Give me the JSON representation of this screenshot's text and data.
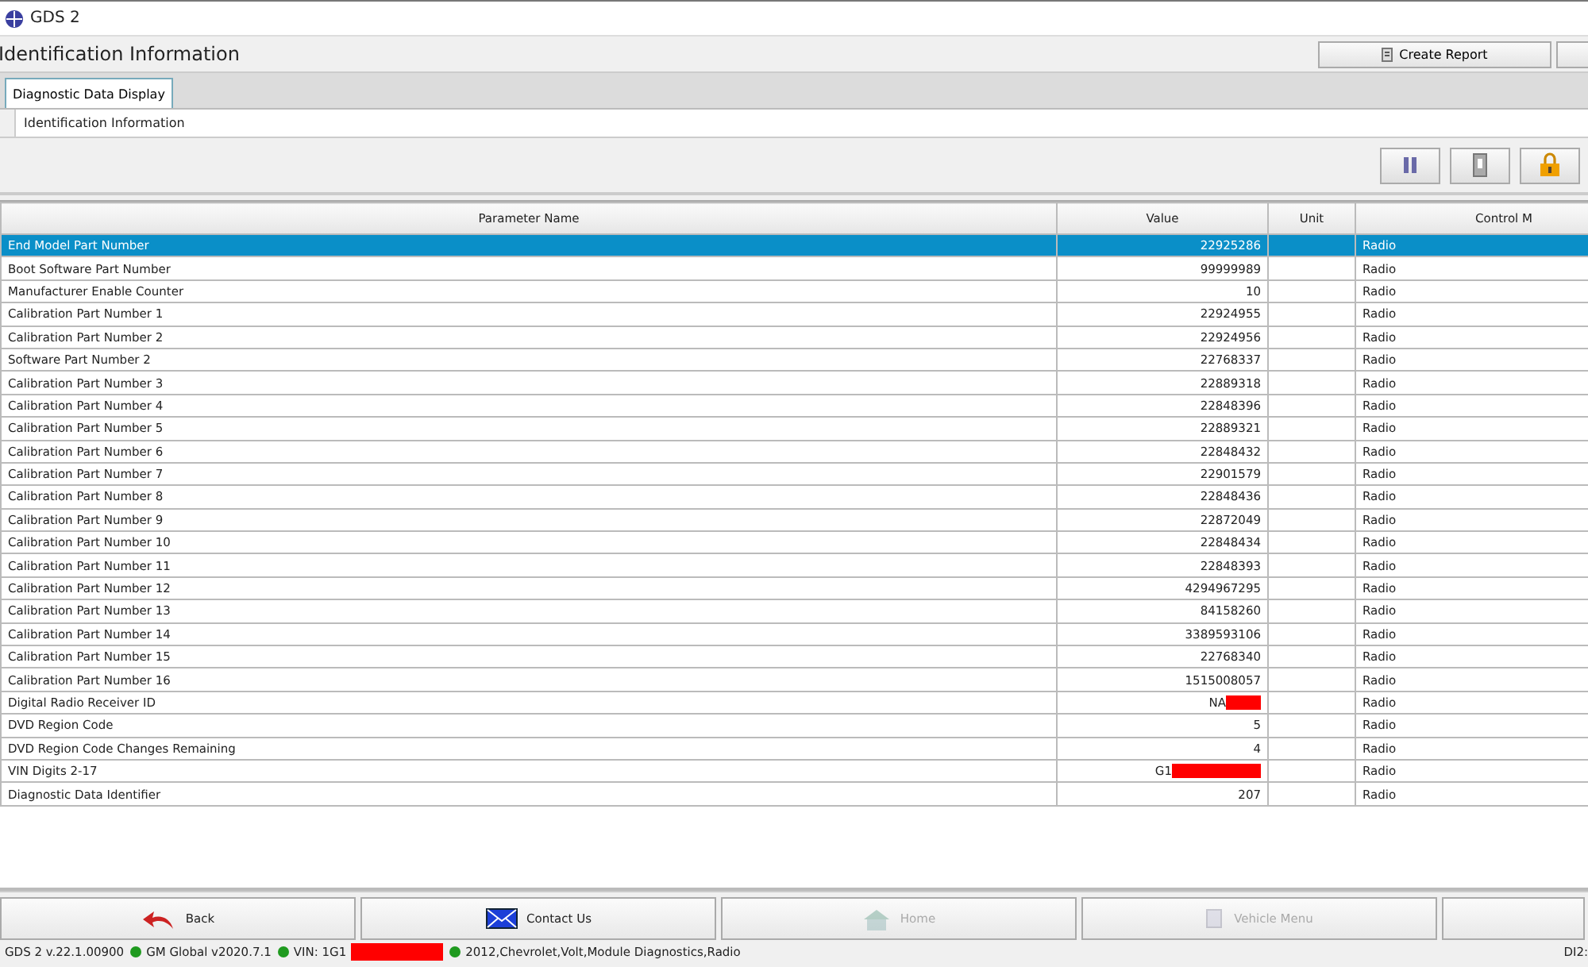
{
  "window": {
    "title": "GDS 2"
  },
  "header": {
    "title": "Identification Information",
    "buttons": [
      {
        "label": "Create Report",
        "kind": "report"
      },
      {
        "kind": "blank"
      }
    ]
  },
  "tabs": [
    {
      "label": "Diagnostic Data Display",
      "selected": true
    }
  ],
  "breadcrumb": "Identification Information",
  "toolbar": [
    {
      "kind": "pause"
    },
    {
      "kind": "switch"
    },
    {
      "kind": "lock"
    }
  ],
  "table": {
    "columns": [
      "Parameter Name",
      "Value",
      "Unit",
      "Control M"
    ],
    "rows": [
      {
        "name": "End Model Part Number",
        "value": "22925286",
        "unit": "",
        "module": "Radio",
        "selected": true
      },
      {
        "name": "Boot Software Part Number",
        "value": "99999989",
        "unit": "",
        "module": "Radio",
        "selected": false
      },
      {
        "name": "Manufacturer Enable Counter",
        "value": "10",
        "unit": "",
        "module": "Radio",
        "selected": false
      },
      {
        "name": "Calibration Part Number 1",
        "value": "22924955",
        "unit": "",
        "module": "Radio",
        "selected": false
      },
      {
        "name": "Calibration Part Number 2",
        "value": "22924956",
        "unit": "",
        "module": "Radio",
        "selected": false
      },
      {
        "name": "Software Part Number 2",
        "value": "22768337",
        "unit": "",
        "module": "Radio",
        "selected": false
      },
      {
        "name": "Calibration Part Number 3",
        "value": "22889318",
        "unit": "",
        "module": "Radio",
        "selected": false
      },
      {
        "name": "Calibration Part Number 4",
        "value": "22848396",
        "unit": "",
        "module": "Radio",
        "selected": false
      },
      {
        "name": "Calibration Part Number 5",
        "value": "22889321",
        "unit": "",
        "module": "Radio",
        "selected": false
      },
      {
        "name": "Calibration Part Number 6",
        "value": "22848432",
        "unit": "",
        "module": "Radio",
        "selected": false
      },
      {
        "name": "Calibration Part Number 7",
        "value": "22901579",
        "unit": "",
        "module": "Radio",
        "selected": false
      },
      {
        "name": "Calibration Part Number 8",
        "value": "22848436",
        "unit": "",
        "module": "Radio",
        "selected": false
      },
      {
        "name": "Calibration Part Number 9",
        "value": "22872049",
        "unit": "",
        "module": "Radio",
        "selected": false
      },
      {
        "name": "Calibration Part Number 10",
        "value": "22848434",
        "unit": "",
        "module": "Radio",
        "selected": false
      },
      {
        "name": "Calibration Part Number 11",
        "value": "22848393",
        "unit": "",
        "module": "Radio",
        "selected": false
      },
      {
        "name": "Calibration Part Number 12",
        "value": "4294967295",
        "unit": "",
        "module": "Radio",
        "selected": false
      },
      {
        "name": "Calibration Part Number 13",
        "value": "84158260",
        "unit": "",
        "module": "Radio",
        "selected": false
      },
      {
        "name": "Calibration Part Number 14",
        "value": "3389593106",
        "unit": "",
        "module": "Radio",
        "selected": false
      },
      {
        "name": "Calibration Part Number 15",
        "value": "22768340",
        "unit": "",
        "module": "Radio",
        "selected": false
      },
      {
        "name": "Calibration Part Number 16",
        "value": "1515008057",
        "unit": "",
        "module": "Radio",
        "selected": false
      },
      {
        "name": "Digital Radio Receiver ID",
        "value": "NA",
        "redacted": true,
        "unit": "",
        "module": "Radio",
        "selected": false
      },
      {
        "name": "DVD Region Code",
        "value": "5",
        "unit": "",
        "module": "Radio",
        "selected": false
      },
      {
        "name": "DVD Region Code Changes Remaining",
        "value": "4",
        "unit": "",
        "module": "Radio",
        "selected": false
      },
      {
        "name": "VIN Digits 2-17",
        "value": "G1",
        "redacted": true,
        "unit": "",
        "module": "Radio",
        "selected": false
      },
      {
        "name": "Diagnostic Data Identifier",
        "value": "207",
        "unit": "",
        "module": "Radio",
        "selected": false
      }
    ]
  },
  "nav_buttons": [
    {
      "label": "Back",
      "kind": "back",
      "disabled": false
    },
    {
      "label": "Contact Us",
      "kind": "contact",
      "disabled": false
    },
    {
      "label": "Home",
      "kind": "home",
      "disabled": true
    },
    {
      "label": "Vehicle Menu",
      "kind": "vehicle",
      "disabled": true
    },
    {
      "kind": "blank"
    }
  ],
  "status_bar": [
    {
      "text": "GDS 2 v.22.1.00900"
    },
    {
      "text": "GM Global v2020.7.1",
      "color": "#1f9a1f"
    },
    {
      "text": "VIN: 1G1",
      "color": "#1f9a1f",
      "redacted": true
    },
    {
      "text": "2012,Chevrolet,Volt,Module Diagnostics,Radio",
      "color": "#1f9a1f"
    },
    {
      "text": "DI2:"
    }
  ]
}
